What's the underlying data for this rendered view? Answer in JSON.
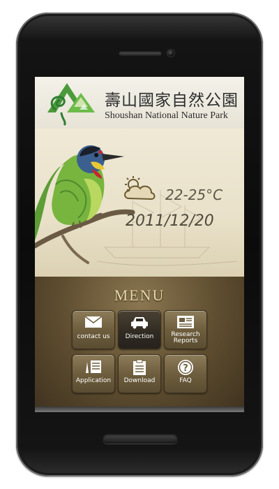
{
  "header": {
    "title_zh": "壽山國家自然公園",
    "title_en": "Shoushan National Nature Park"
  },
  "weather": {
    "icon": "partly-cloudy-icon",
    "temperature": "22-25°C",
    "date": "2011/12/20"
  },
  "menu": {
    "title": "MENU",
    "items": [
      {
        "label": "contact us",
        "icon": "envelope-icon"
      },
      {
        "label": "Direction",
        "icon": "car-icon"
      },
      {
        "label_line1": "Research",
        "label_line2": "Reports",
        "icon": "newspaper-icon"
      },
      {
        "label": "Application",
        "icon": "form-icon"
      },
      {
        "label": "Download",
        "icon": "clipboard-icon"
      },
      {
        "label": "FAQ",
        "icon": "question-icon"
      }
    ],
    "active_item": "Direction"
  },
  "colors": {
    "menu_panel": "#5d4c2f",
    "menu_title": "#e8d9a8",
    "logo_green": "#3f9a3a",
    "hero_bg": "#efe9d6"
  }
}
